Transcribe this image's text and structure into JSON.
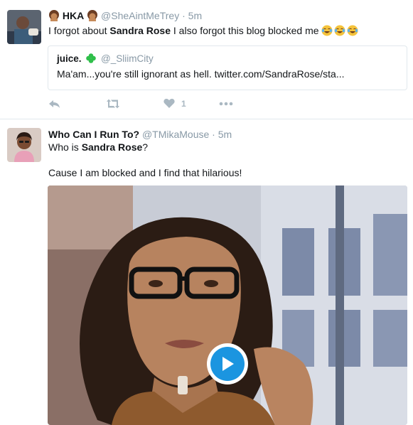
{
  "tweets": [
    {
      "name": "HKA",
      "handle": "@SheAintMeTrey",
      "separator": "·",
      "time": "5m",
      "text_parts": [
        "I forgot about ",
        "Sandra Rose",
        " I also forgot this blog blocked me "
      ],
      "emoji_name": "face-with-tears-of-joy",
      "quote": {
        "name": "juice.",
        "handle": "@_SliimCity",
        "text": "Ma'am...you're still ignorant as hell. twitter.com/SandraRose/sta..."
      },
      "like_count": "1"
    },
    {
      "name": "Who Can I Run To?",
      "handle": "@TMikaMouse",
      "separator": "·",
      "time": "5m",
      "line1_parts": [
        "Who is ",
        "Sandra Rose",
        "?"
      ],
      "line2": "Cause I am blocked and I find that hilarious!"
    }
  ],
  "colors": {
    "meta": "#8899a6",
    "action_icon": "#aab8c2",
    "play_blue": "#1b95e0",
    "clover": "#2fbf4a",
    "divider": "#e1e8ed"
  },
  "icons": [
    "reply-icon",
    "retweet-icon",
    "like-icon",
    "more-icon",
    "play-icon",
    "clover-icon",
    "woman-emoji-icon",
    "face-with-tears-of-joy-emoji"
  ]
}
